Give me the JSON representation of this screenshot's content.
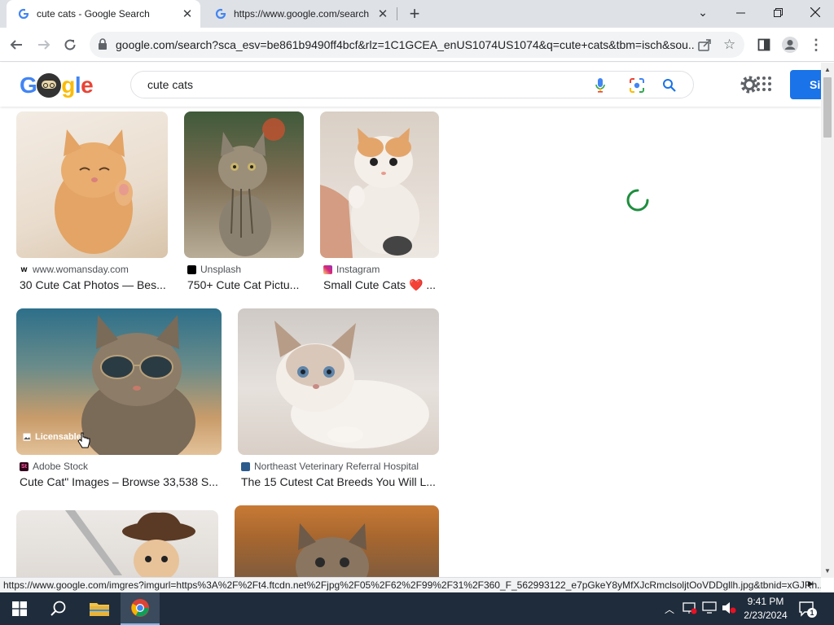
{
  "browser": {
    "tabs": [
      {
        "title": "cute cats - Google Search",
        "active": true
      },
      {
        "title": "https://www.google.com/search",
        "active": false
      }
    ],
    "new_tab": "+",
    "url": "google.com/search?sca_esv=be861b9490ff4bcf&rlz=1C1GCEA_enUS1074US1074&q=cute+cats&tbm=isch&sou...",
    "status_url": "https://www.google.com/imgres?imgurl=https%3A%2F%2Ft4.ftcdn.net%2Fjpg%2F05%2F62%2F99%2F31%2F360_F_562993122_e7pGkeY8yMfXJcRmclsoljtOoVDDgllh.jpg&tbnid=xGJRh..."
  },
  "google": {
    "logo": "Google",
    "query": "cute cats",
    "signin_label": "Si"
  },
  "results": [
    {
      "source": "www.womansday.com",
      "title": "30 Cute Cat Photos — Bes...",
      "source_icon": "womansday-icon"
    },
    {
      "source": "Unsplash",
      "title": "750+ Cute Cat Pictu...",
      "source_icon": "unsplash-icon"
    },
    {
      "source": "Instagram",
      "title": "Small Cute Cats ❤️ ...",
      "source_icon": "instagram-icon"
    },
    {
      "source": "Adobe Stock",
      "title": "Cute Cat\" Images – Browse 33,538 S...",
      "source_icon": "adobe-stock-icon",
      "badge": "Licensable"
    },
    {
      "source": "Northeast Veterinary Referral Hospital",
      "title": "The 15 Cutest Cat Breeds You Will L...",
      "source_icon": "hospital-icon"
    }
  ],
  "taskbar": {
    "time": "9:41 PM",
    "date": "2/23/2024",
    "notification_count": "1"
  },
  "colors": {
    "accent": "#1a73e8",
    "taskbar": "#1f2c3b",
    "spinner": "#1e8e3e"
  }
}
